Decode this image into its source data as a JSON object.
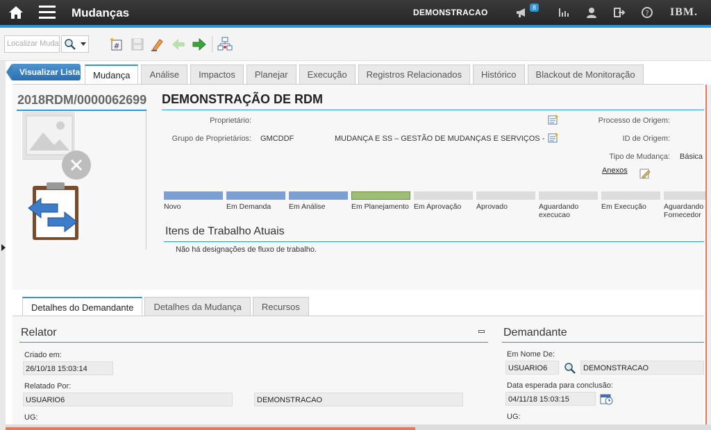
{
  "topbar": {
    "title": "Mudanças",
    "user": "DEMONSTRACAO",
    "notif_count": "8",
    "brand": "IBM."
  },
  "toolbar": {
    "search_placeholder": "Localizar Muda"
  },
  "nav": {
    "back_label": "Visualizar Lista",
    "tabs": [
      "Mudança",
      "Análise",
      "Impactos",
      "Planejar",
      "Execução",
      "Registros Relacionados",
      "Histórico",
      "Blackout de Monitoração"
    ]
  },
  "record": {
    "id": "2018RDM/0000062699",
    "title": "DEMONSTRAÇÃO DE RDM",
    "owner_label": "Proprietário:",
    "owner_group_label": "Grupo de Proprietários:",
    "owner_group_code": "GMCDDF",
    "owner_group_desc": "MUDANÇA E SS – GESTÃO DE MUDANÇAS E SERVIÇOS -",
    "origin_process_label": "Processo de Origem:",
    "origin_id_label": "ID de Origem:",
    "change_type_label": "Tipo de Mudança:",
    "change_type_value": "Básica",
    "attachments_label": "Anexos"
  },
  "workflow": {
    "steps": [
      {
        "label": "Novo",
        "state": "done"
      },
      {
        "label": "Em Demanda",
        "state": "done"
      },
      {
        "label": "Em Análise",
        "state": "done"
      },
      {
        "label": "Em Planejamento",
        "state": "current"
      },
      {
        "label": "Em Aprovação",
        "state": "pending"
      },
      {
        "label": "Aprovado",
        "state": "pending"
      },
      {
        "label": "Aguardando execucao",
        "state": "pending"
      },
      {
        "label": "Em Execução",
        "state": "pending"
      },
      {
        "label": "Aguardando Fornecedor",
        "state": "pending"
      }
    ],
    "colors": {
      "done": "#7b9fd3",
      "current": "#9dbd78",
      "pending": "#dcdcdc"
    }
  },
  "work_items": {
    "title": "Itens de Trabalho Atuais",
    "empty_text": "Não há designações de fluxo de trabalho."
  },
  "bottom_tabs": [
    "Detalhes do Demandante",
    "Detalhes da Mudança",
    "Recursos"
  ],
  "relator": {
    "title": "Relator",
    "created_label": "Criado em:",
    "created_value": "26/10/18 15:03:14",
    "reported_by_label": "Relatado Por:",
    "reported_by_user": "USUARIO6",
    "reported_by_name": "DEMONSTRACAO",
    "ug_label": "UG:"
  },
  "demandante": {
    "title": "Demandante",
    "on_behalf_label": "Em Nome De:",
    "on_behalf_user": "USUARIO6",
    "on_behalf_name": "DEMONSTRACAO",
    "expected_date_label": "Data esperada para conclusão:",
    "expected_date_value": "04/11/18 15:03:15",
    "ug_label": "UG:"
  }
}
